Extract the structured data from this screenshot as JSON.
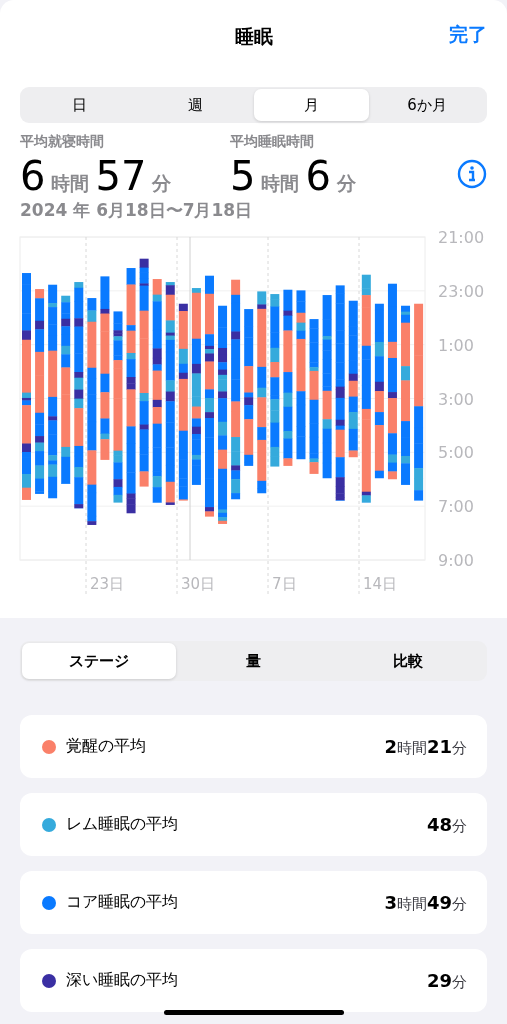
{
  "header": {
    "title": "睡眠",
    "done": "完了"
  },
  "period_tabs": [
    {
      "label": "日",
      "selected": false
    },
    {
      "label": "週",
      "selected": false
    },
    {
      "label": "月",
      "selected": true
    },
    {
      "label": "6か月",
      "selected": false
    }
  ],
  "stats": [
    {
      "label": "平均就寝時間",
      "parts": [
        {
          "number": "6",
          "unit": "時間"
        },
        {
          "number": "57",
          "unit": "分"
        }
      ]
    },
    {
      "label": "平均睡眠時間",
      "parts": [
        {
          "number": "5",
          "unit": "時間"
        },
        {
          "number": "6",
          "unit": "分"
        }
      ]
    }
  ],
  "date_range": "2024 年 6月18日〜7月18日",
  "chart": {
    "y_labels": [
      "21:00",
      "23:00",
      "1:00",
      "3:00",
      "5:00",
      "7:00",
      "9:00"
    ],
    "x_labels": [
      "23日",
      "30日",
      "7日",
      "14日"
    ]
  },
  "view_tabs": [
    {
      "label": "ステージ",
      "selected": true
    },
    {
      "label": "量",
      "selected": false
    },
    {
      "label": "比較",
      "selected": false
    }
  ],
  "averages": [
    {
      "label": "覚醒の平均",
      "value": "**2**時間**21**分",
      "color": "#fa8069"
    },
    {
      "label": "レム睡眠の平均",
      "value": "**48**分",
      "color": "#35aadc"
    },
    {
      "label": "コア睡眠の平均",
      "value": "**3**時間**49**分",
      "color": "#0a7aff"
    },
    {
      "label": "深い睡眠の平均",
      "value": "**29**分",
      "color": "#3a2fa3"
    }
  ]
}
